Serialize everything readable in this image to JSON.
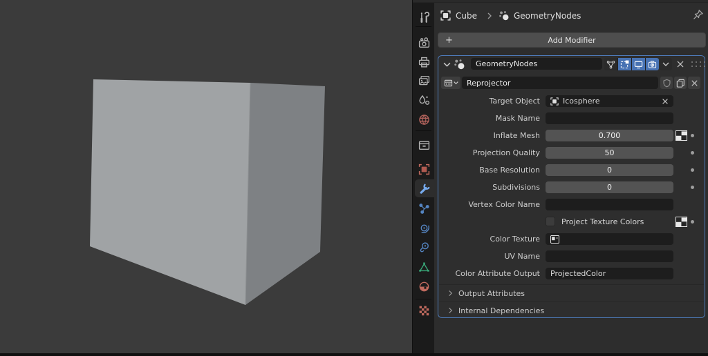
{
  "app": "Blender",
  "editor": "Properties",
  "breadcrumb": {
    "object_label": "Cube",
    "modifier_label": "GeometryNodes"
  },
  "add_modifier": {
    "label": "Add Modifier"
  },
  "modifier": {
    "name": "GeometryNodes",
    "node_group": "Reprojector",
    "display_toggles": [
      {
        "name": "edit-mode-vertex-toggle",
        "on": false
      },
      {
        "name": "on-cage-toggle",
        "on": true
      },
      {
        "name": "viewport-display-toggle",
        "on": true
      },
      {
        "name": "render-display-toggle",
        "on": true
      }
    ],
    "rows": [
      {
        "label": "Target Object",
        "value": "Icosphere",
        "type": "object",
        "clearable": true
      },
      {
        "label": "Mask Name",
        "value": "",
        "type": "text"
      },
      {
        "label": "Inflate Mesh",
        "value": "0.700",
        "type": "slider",
        "attr_toggle": true,
        "keyframe_dot": true
      },
      {
        "label": "Projection Quality",
        "value": "50",
        "type": "slider",
        "keyframe_dot": true
      },
      {
        "label": "Base Resolution",
        "value": "0",
        "type": "slider",
        "keyframe_dot": true
      },
      {
        "label": "Subdivisions",
        "value": "0",
        "type": "slider",
        "keyframe_dot": true
      },
      {
        "label": "Vertex Color Name",
        "value": "",
        "type": "text"
      },
      {
        "label": "Project Texture Colors",
        "checked": false,
        "type": "checkbox",
        "attr_toggle": true,
        "keyframe_dot": true
      },
      {
        "label": "Color Texture",
        "value": "",
        "type": "texture"
      },
      {
        "label": "UV Name",
        "value": "",
        "type": "text"
      },
      {
        "label": "Color Attribute Output",
        "value": "ProjectedColor",
        "type": "text"
      }
    ],
    "subpanels": [
      {
        "label": "Output Attributes",
        "expanded": false
      },
      {
        "label": "Internal Dependencies",
        "expanded": false
      }
    ]
  },
  "tabbar": {
    "active_tab": "modifiers",
    "tabs": [
      {
        "name": "tool",
        "color": "#b4b4b4"
      },
      {
        "name": "render",
        "color": "#b4b4b4"
      },
      {
        "name": "output",
        "color": "#b4b4b4"
      },
      {
        "name": "view-layer",
        "color": "#b4b4b4"
      },
      {
        "name": "scene",
        "color": "#b4b4b4"
      },
      {
        "name": "world",
        "color": "#b3635c"
      },
      {
        "name": "collection",
        "color": "#b4b4b4"
      },
      {
        "name": "object",
        "color": "#c06a5e"
      },
      {
        "name": "modifiers",
        "color": "#76aaed",
        "active": true
      },
      {
        "name": "particles",
        "color": "#5585c2"
      },
      {
        "name": "physics",
        "color": "#5585c2"
      },
      {
        "name": "constraints",
        "color": "#5585c2"
      },
      {
        "name": "object-data",
        "color": "#39a878"
      },
      {
        "name": "material",
        "color": "#c06a5e"
      },
      {
        "name": "texture",
        "color": "#c06a5e"
      }
    ]
  },
  "viewport_scene": {
    "object": "Cube",
    "background": "#3b3b3b",
    "cube_front_color": "#a0a3a5",
    "cube_side_color": "#7e8184"
  },
  "colors": {
    "accent_blue": "#4772b3",
    "active_modifier_outline": "#4d7ab8",
    "panel_bg": "#2d2d2d",
    "field_bg": "#1d1d1d",
    "slider_bg": "#535353",
    "button_bg": "#3d3d3d",
    "tabbar_bg": "#1b1b1b"
  }
}
